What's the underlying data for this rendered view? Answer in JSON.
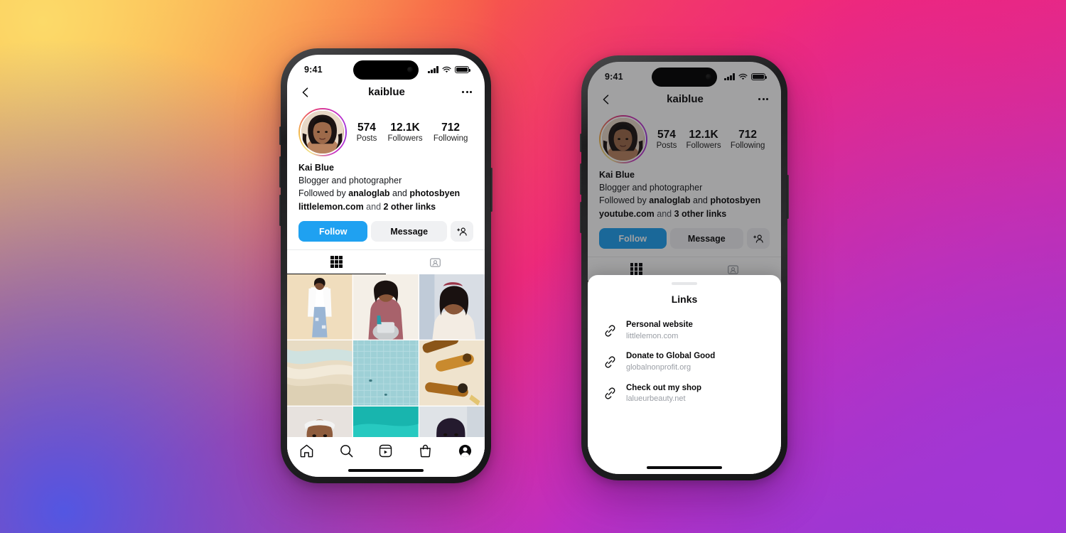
{
  "background": {
    "colors": [
      "#FCDA69",
      "#FBAE3C",
      "#F75C45",
      "#F0257C",
      "#EE2A7B",
      "#C22DBE",
      "#A236D6",
      "#5356E2"
    ]
  },
  "accent": {
    "follow_blue": "#1FA1F1",
    "button_gray": "#F0F1F3",
    "muted_text": "#9a9ea5"
  },
  "phone_left": {
    "status": {
      "time": "9:41",
      "signal_icon": "cellular-bars-icon",
      "wifi_icon": "wifi-icon",
      "battery_icon": "battery-icon"
    },
    "nav": {
      "back_icon": "chevron-left-icon",
      "title": "kaiblue",
      "more_icon": "ellipsis-icon"
    },
    "profile": {
      "avatar_icon": "profile-avatar",
      "stats": [
        {
          "value": "574",
          "label": "Posts"
        },
        {
          "value": "12.1K",
          "label": "Followers"
        },
        {
          "value": "712",
          "label": "Following"
        }
      ],
      "name": "Kai Blue",
      "description": "Blogger and photographer",
      "followed_by_prefix": "Followed by ",
      "followed_by_1": "analoglab",
      "followed_by_mid": " and ",
      "followed_by_2": "photosbyen",
      "link_primary": "littlelemon.com",
      "link_rest_prefix": " and ",
      "link_rest": "2 other links"
    },
    "actions": {
      "follow": "Follow",
      "message": "Message",
      "add_user_icon": "add-person-icon"
    },
    "tabs": [
      {
        "name": "grid",
        "icon": "grid-icon",
        "active": true
      },
      {
        "name": "tagged",
        "icon": "tagged-person-icon",
        "active": false
      }
    ],
    "tabbar": [
      {
        "name": "home",
        "icon": "home-icon"
      },
      {
        "name": "search",
        "icon": "search-icon"
      },
      {
        "name": "reels",
        "icon": "reels-icon"
      },
      {
        "name": "shop",
        "icon": "shop-bag-icon"
      },
      {
        "name": "profile",
        "icon": "profile-circle-icon"
      }
    ]
  },
  "phone_right": {
    "status": {
      "time": "9:41"
    },
    "nav": {
      "title": "kaiblue"
    },
    "profile": {
      "stats": [
        {
          "value": "574",
          "label": "Posts"
        },
        {
          "value": "12.1K",
          "label": "Followers"
        },
        {
          "value": "712",
          "label": "Following"
        }
      ],
      "name": "Kai Blue",
      "description": "Blogger and photographer",
      "followed_by_prefix": "Followed by ",
      "followed_by_1": "analoglab",
      "followed_by_mid": " and ",
      "followed_by_2": "photosbyen",
      "link_primary": "youtube.com",
      "link_rest_prefix": " and ",
      "link_rest": "3 other links"
    },
    "actions": {
      "follow": "Follow",
      "message": "Message"
    },
    "sheet": {
      "grabber_icon": "sheet-grabber",
      "title": "Links",
      "items": [
        {
          "icon": "link-chain-icon",
          "title": "Personal website",
          "url": "littlelemon.com"
        },
        {
          "icon": "link-chain-icon",
          "title": "Donate to Global Good",
          "url": "globalnonprofit.org"
        },
        {
          "icon": "link-chain-icon",
          "title": "Check out my shop",
          "url": "lalueurbeauty.net"
        }
      ]
    }
  }
}
